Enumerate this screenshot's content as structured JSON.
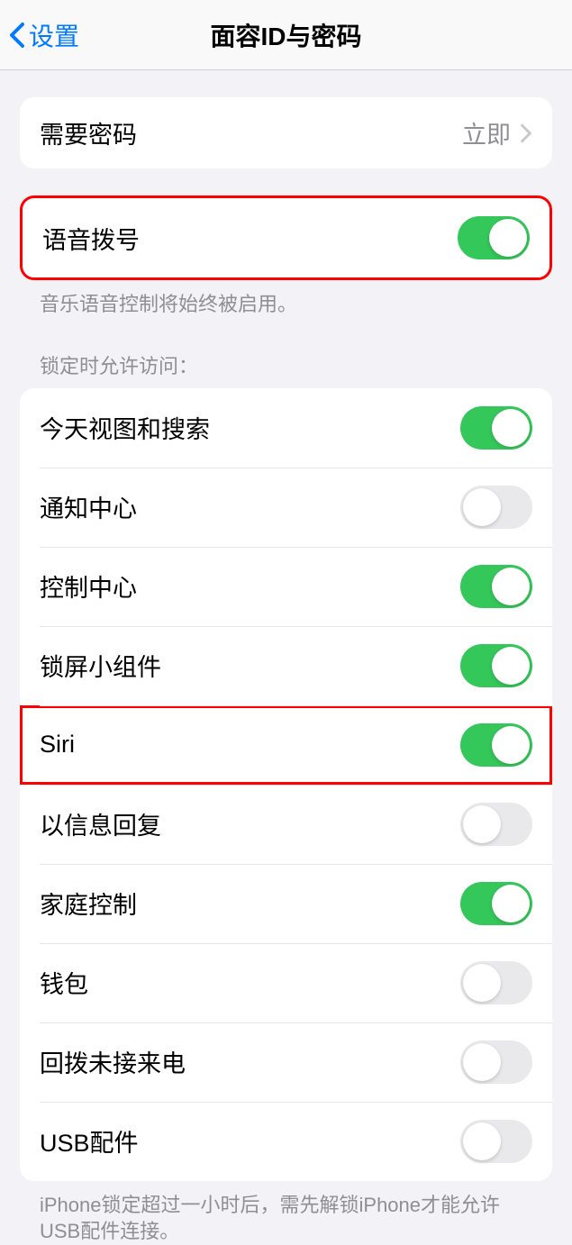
{
  "navbar": {
    "back_label": "设置",
    "title": "面容ID与密码"
  },
  "require_passcode": {
    "label": "需要密码",
    "value": "立即"
  },
  "voice_dial": {
    "label": "语音拨号",
    "footer": "音乐语音控制将始终被启用。",
    "enabled": true
  },
  "lock_access": {
    "header": "锁定时允许访问：",
    "items": [
      {
        "label": "今天视图和搜索",
        "enabled": true
      },
      {
        "label": "通知中心",
        "enabled": false
      },
      {
        "label": "控制中心",
        "enabled": true
      },
      {
        "label": "锁屏小组件",
        "enabled": true
      },
      {
        "label": "Siri",
        "enabled": true
      },
      {
        "label": "以信息回复",
        "enabled": false
      },
      {
        "label": "家庭控制",
        "enabled": true
      },
      {
        "label": "钱包",
        "enabled": false
      },
      {
        "label": "回拨未接来电",
        "enabled": false
      },
      {
        "label": "USB配件",
        "enabled": false
      }
    ],
    "footer": "iPhone锁定超过一小时后，需先解锁iPhone才能允许USB配件连接。"
  }
}
